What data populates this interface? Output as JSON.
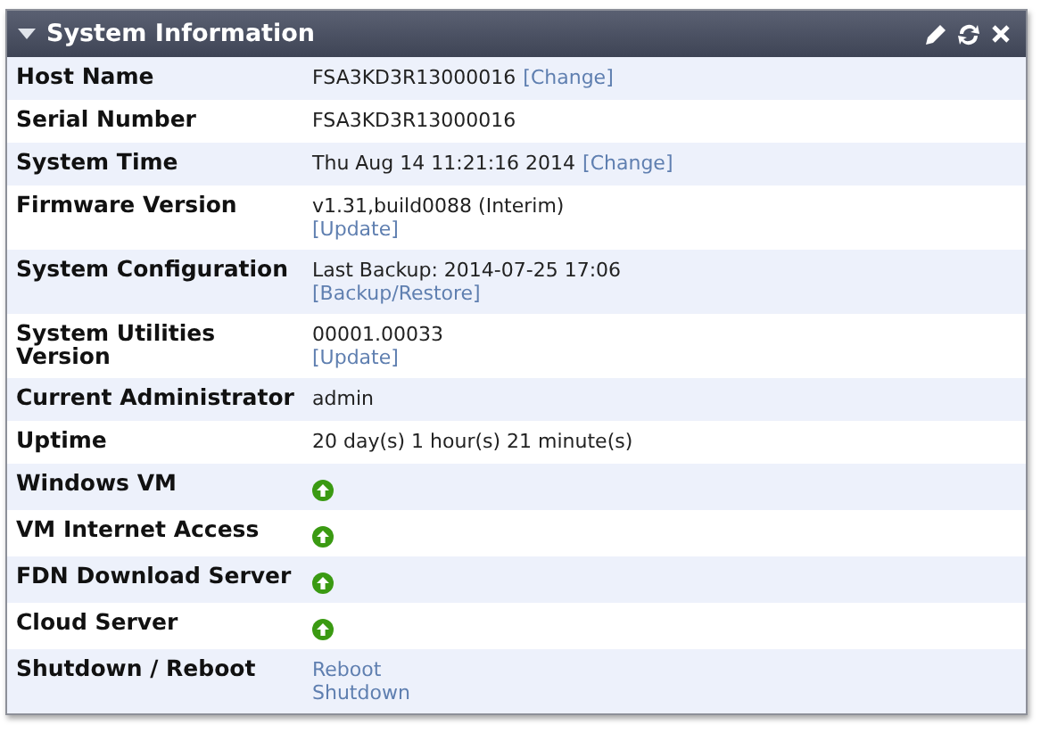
{
  "widget": {
    "title": "System Information",
    "collapsed": false
  },
  "rows": [
    {
      "label": "Host Name",
      "lines": [
        [
          {
            "kind": "text",
            "text": "FSA3KD3R13000016"
          },
          {
            "kind": "link",
            "text": "[Change]"
          }
        ]
      ]
    },
    {
      "label": "Serial Number",
      "lines": [
        [
          {
            "kind": "text",
            "text": "FSA3KD3R13000016"
          }
        ]
      ]
    },
    {
      "label": "System Time",
      "lines": [
        [
          {
            "kind": "text",
            "text": "Thu Aug 14 11:21:16 2014"
          },
          {
            "kind": "link",
            "text": "[Change]"
          }
        ]
      ]
    },
    {
      "label": "Firmware Version",
      "lines": [
        [
          {
            "kind": "text",
            "text": "v1.31,build0088 (Interim)"
          }
        ],
        [
          {
            "kind": "link",
            "text": "[Update]"
          }
        ]
      ]
    },
    {
      "label": "System Configuration",
      "lines": [
        [
          {
            "kind": "text",
            "text": "Last Backup: 2014-07-25 17:06"
          }
        ],
        [
          {
            "kind": "link",
            "text": "[Backup/Restore]"
          }
        ]
      ]
    },
    {
      "label": "System Utilities Version",
      "lines": [
        [
          {
            "kind": "text",
            "text": "00001.00033"
          }
        ],
        [
          {
            "kind": "link",
            "text": "[Update]"
          }
        ]
      ]
    },
    {
      "label": "Current Administrator",
      "lines": [
        [
          {
            "kind": "text",
            "text": "admin"
          }
        ]
      ]
    },
    {
      "label": "Uptime",
      "lines": [
        [
          {
            "kind": "text",
            "text": "20 day(s) 1 hour(s) 21 minute(s)"
          }
        ]
      ]
    },
    {
      "label": "Windows VM",
      "lines": [
        [
          {
            "kind": "status",
            "up": true
          }
        ]
      ]
    },
    {
      "label": "VM Internet Access",
      "lines": [
        [
          {
            "kind": "status",
            "up": true
          }
        ]
      ]
    },
    {
      "label": "FDN Download Server",
      "lines": [
        [
          {
            "kind": "status",
            "up": true
          }
        ]
      ]
    },
    {
      "label": "Cloud Server",
      "lines": [
        [
          {
            "kind": "status",
            "up": true
          }
        ]
      ]
    },
    {
      "label": "Shutdown / Reboot",
      "lines": [
        [
          {
            "kind": "link",
            "text": "Reboot"
          }
        ],
        [
          {
            "kind": "link",
            "text": "Shutdown"
          }
        ]
      ]
    }
  ]
}
